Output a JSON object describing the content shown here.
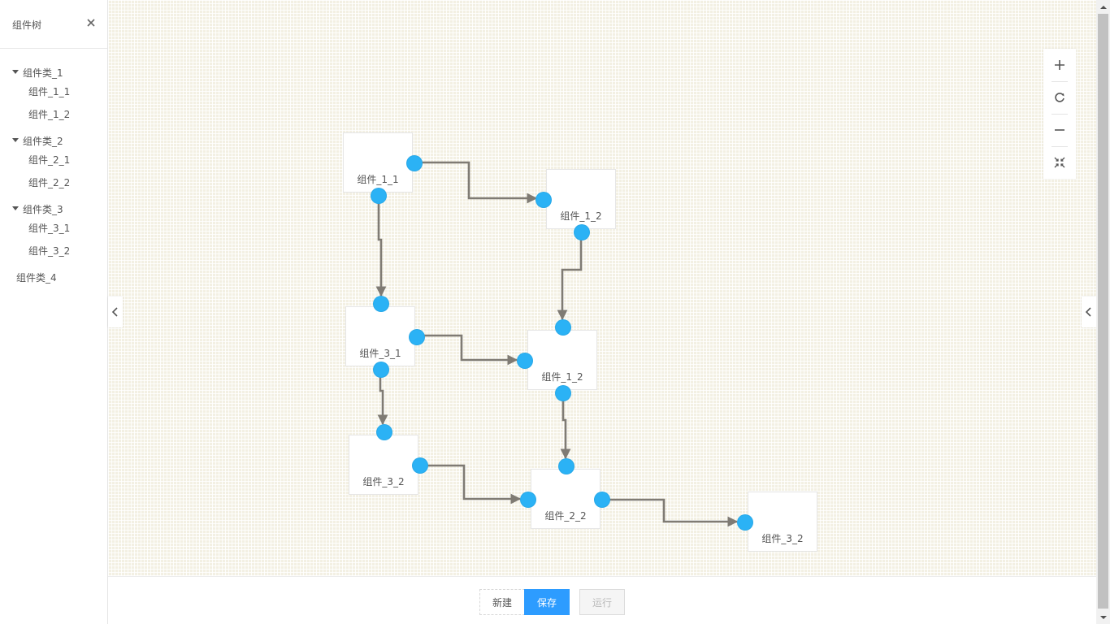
{
  "sidebar": {
    "title": "组件树",
    "groups": [
      {
        "label": "组件类_1",
        "expanded": true,
        "items": [
          "组件_1_1",
          "组件_1_2"
        ]
      },
      {
        "label": "组件类_2",
        "expanded": true,
        "items": [
          "组件_2_1",
          "组件_2_2"
        ]
      },
      {
        "label": "组件类_3",
        "expanded": true,
        "items": [
          "组件_3_1",
          "组件_3_2"
        ]
      },
      {
        "label": "组件类_4",
        "expanded": false,
        "items": []
      }
    ]
  },
  "canvas": {
    "nodes": [
      {
        "id": "n1",
        "label": "组件_1_1"
      },
      {
        "id": "n2",
        "label": "组件_1_2"
      },
      {
        "id": "n3",
        "label": "组件_3_1"
      },
      {
        "id": "n4",
        "label": "组件_1_2"
      },
      {
        "id": "n5",
        "label": "组件_3_2"
      },
      {
        "id": "n6",
        "label": "组件_2_2"
      },
      {
        "id": "n7",
        "label": "组件_3_2"
      }
    ],
    "edges": [
      {
        "from": "n1",
        "to": "n2"
      },
      {
        "from": "n1",
        "to": "n3"
      },
      {
        "from": "n2",
        "to": "n4"
      },
      {
        "from": "n3",
        "to": "n4"
      },
      {
        "from": "n3",
        "to": "n5"
      },
      {
        "from": "n4",
        "to": "n6"
      },
      {
        "from": "n5",
        "to": "n6"
      },
      {
        "from": "n6",
        "to": "n7"
      }
    ],
    "colors": {
      "port": "#2bb2f5",
      "edge": "#7f7b74",
      "background": "#f3f0e3"
    }
  },
  "zoom_toolbar": {
    "icons": [
      "zoom-in-icon",
      "reset-zoom-icon",
      "zoom-out-icon",
      "fit-view-icon"
    ]
  },
  "actions": {
    "new_label": "新建",
    "save_label": "保存",
    "run_label": "运行"
  },
  "colors": {
    "primary": "#2d9cff"
  }
}
